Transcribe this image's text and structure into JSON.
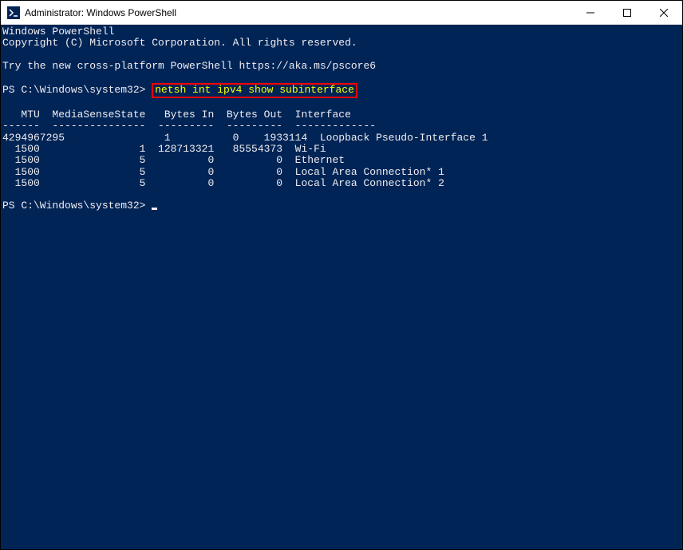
{
  "titlebar": {
    "title": "Administrator: Windows PowerShell"
  },
  "banner": {
    "line1": "Windows PowerShell",
    "line2": "Copyright (C) Microsoft Corporation. All rights reserved.",
    "line3": "Try the new cross-platform PowerShell https://aka.ms/pscore6"
  },
  "prompt1": {
    "prefix": "PS C:\\Windows\\system32> ",
    "command": "netsh int ipv4 show subinterface"
  },
  "table": {
    "header": "   MTU  MediaSenseState   Bytes In  Bytes Out  Interface",
    "divider": "------  ---------------  ---------  ---------  -------------",
    "rows": [
      "4294967295                1          0    1933114  Loopback Pseudo-Interface 1",
      "  1500                1  128713321   85554373  Wi-Fi",
      "  1500                5          0          0  Ethernet",
      "  1500                5          0          0  Local Area Connection* 1",
      "  1500                5          0          0  Local Area Connection* 2"
    ]
  },
  "prompt2": {
    "prefix": "PS C:\\Windows\\system32> "
  }
}
